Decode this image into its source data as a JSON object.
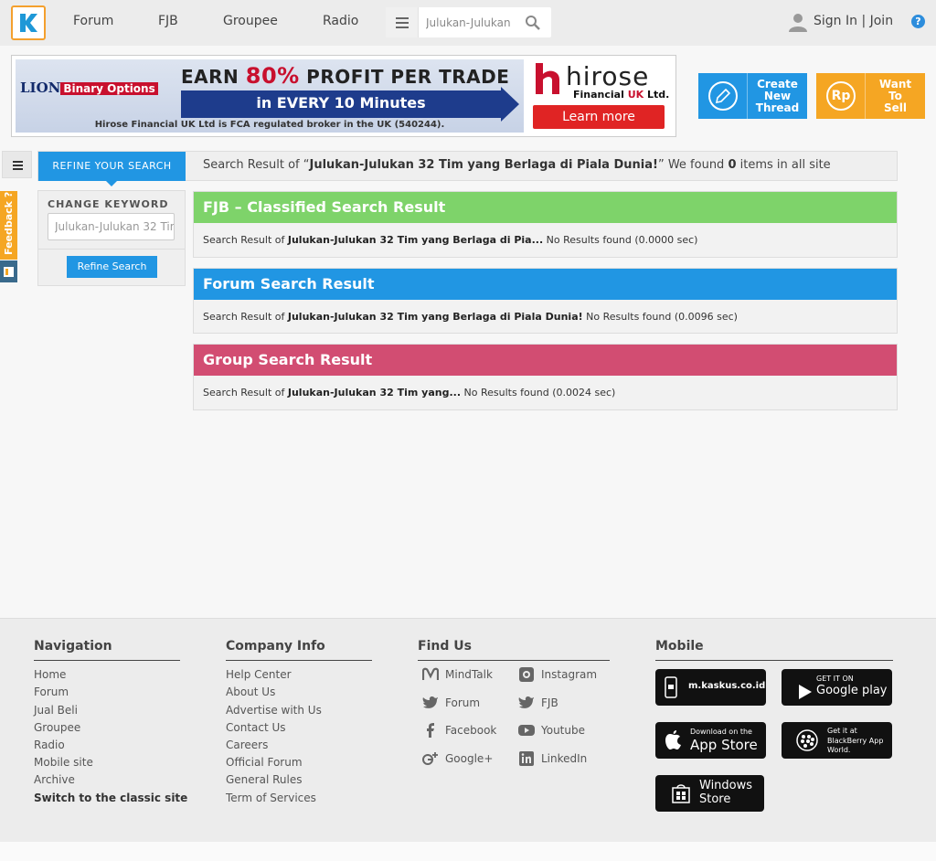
{
  "nav": {
    "items": [
      "Forum",
      "FJB",
      "Groupee",
      "Radio"
    ],
    "search_value": "Julukan-Julukan",
    "signin": "Sign In | Join",
    "help": "?"
  },
  "banner": {
    "lion_text": "LION",
    "lion_tag": "Binary Options",
    "earn_pre": "EARN ",
    "earn_pct": "80%",
    "earn_post": " PROFIT PER TRADE",
    "arrow_text": "in EVERY  10  Minutes",
    "reg_text": "Hirose Financial UK Ltd is FCA regulated broker in the UK (540244).",
    "hirose_name": "hirose",
    "hirose_sub_pre": "Financial ",
    "hirose_sub_uk": "UK",
    "hirose_sub_post": " Ltd.",
    "learn_more": "Learn more"
  },
  "actions": {
    "create_thread": "Create New Thread",
    "want_to_sell": "Want To Sell",
    "sell_icon": "Rp"
  },
  "refine": {
    "tab_label": "REFINE YOUR SEARCH",
    "summary_pre": "Search Result of “",
    "keyword": "Julukan-Julukan 32 Tim yang Berlaga di Piala Dunia!",
    "summary_mid": "” We found ",
    "count": "0",
    "summary_post": " items in all site",
    "side_title": "CHANGE KEYWORD",
    "side_input": "Julukan-Julukan 32 Tim",
    "side_button": "Refine Search",
    "feedback": "Feedback ?"
  },
  "results": [
    {
      "title": "FJB – Classified Search Result",
      "prefix": "Search Result of ",
      "keyword": "Julukan-Julukan 32 Tim yang Berlaga di Pia...",
      "status": "  No Results found (0.0000 sec)"
    },
    {
      "title": "Forum Search Result",
      "prefix": "Search Result of ",
      "keyword": "Julukan-Julukan 32 Tim yang Berlaga di Piala Dunia!",
      "status": " No Results found (0.0096 sec)"
    },
    {
      "title": "Group Search Result",
      "prefix": "Search Result of ",
      "keyword": "Julukan-Julukan 32 Tim yang...",
      "status": " No Results found (0.0024 sec)"
    }
  ],
  "footer": {
    "navigation": {
      "title": "Navigation",
      "links": [
        "Home",
        "Forum",
        "Jual Beli",
        "Groupee",
        "Radio",
        "Mobile site",
        "Archive",
        "Switch to the classic site"
      ]
    },
    "company": {
      "title": "Company Info",
      "links": [
        "Help Center",
        "About Us",
        "Advertise with Us",
        "Contact Us",
        "Careers",
        "Official Forum",
        "General Rules",
        "Term of Services"
      ]
    },
    "findus": {
      "title": "Find Us",
      "left": [
        "MindTalk",
        "Forum",
        "Facebook",
        "Google+"
      ],
      "right": [
        "Instagram",
        "FJB",
        "Youtube",
        "LinkedIn"
      ]
    },
    "mobile": {
      "title": "Mobile",
      "mkaskus": "m.kaskus.co.id",
      "gp_small": "GET IT ON",
      "gp_big": "Google play",
      "as_small": "Download on the",
      "as_big": "App Store",
      "bb_small": "Get it at",
      "bb_big": "BlackBerry App World.",
      "ws_big1": "Windows",
      "ws_big2": "Store"
    }
  }
}
